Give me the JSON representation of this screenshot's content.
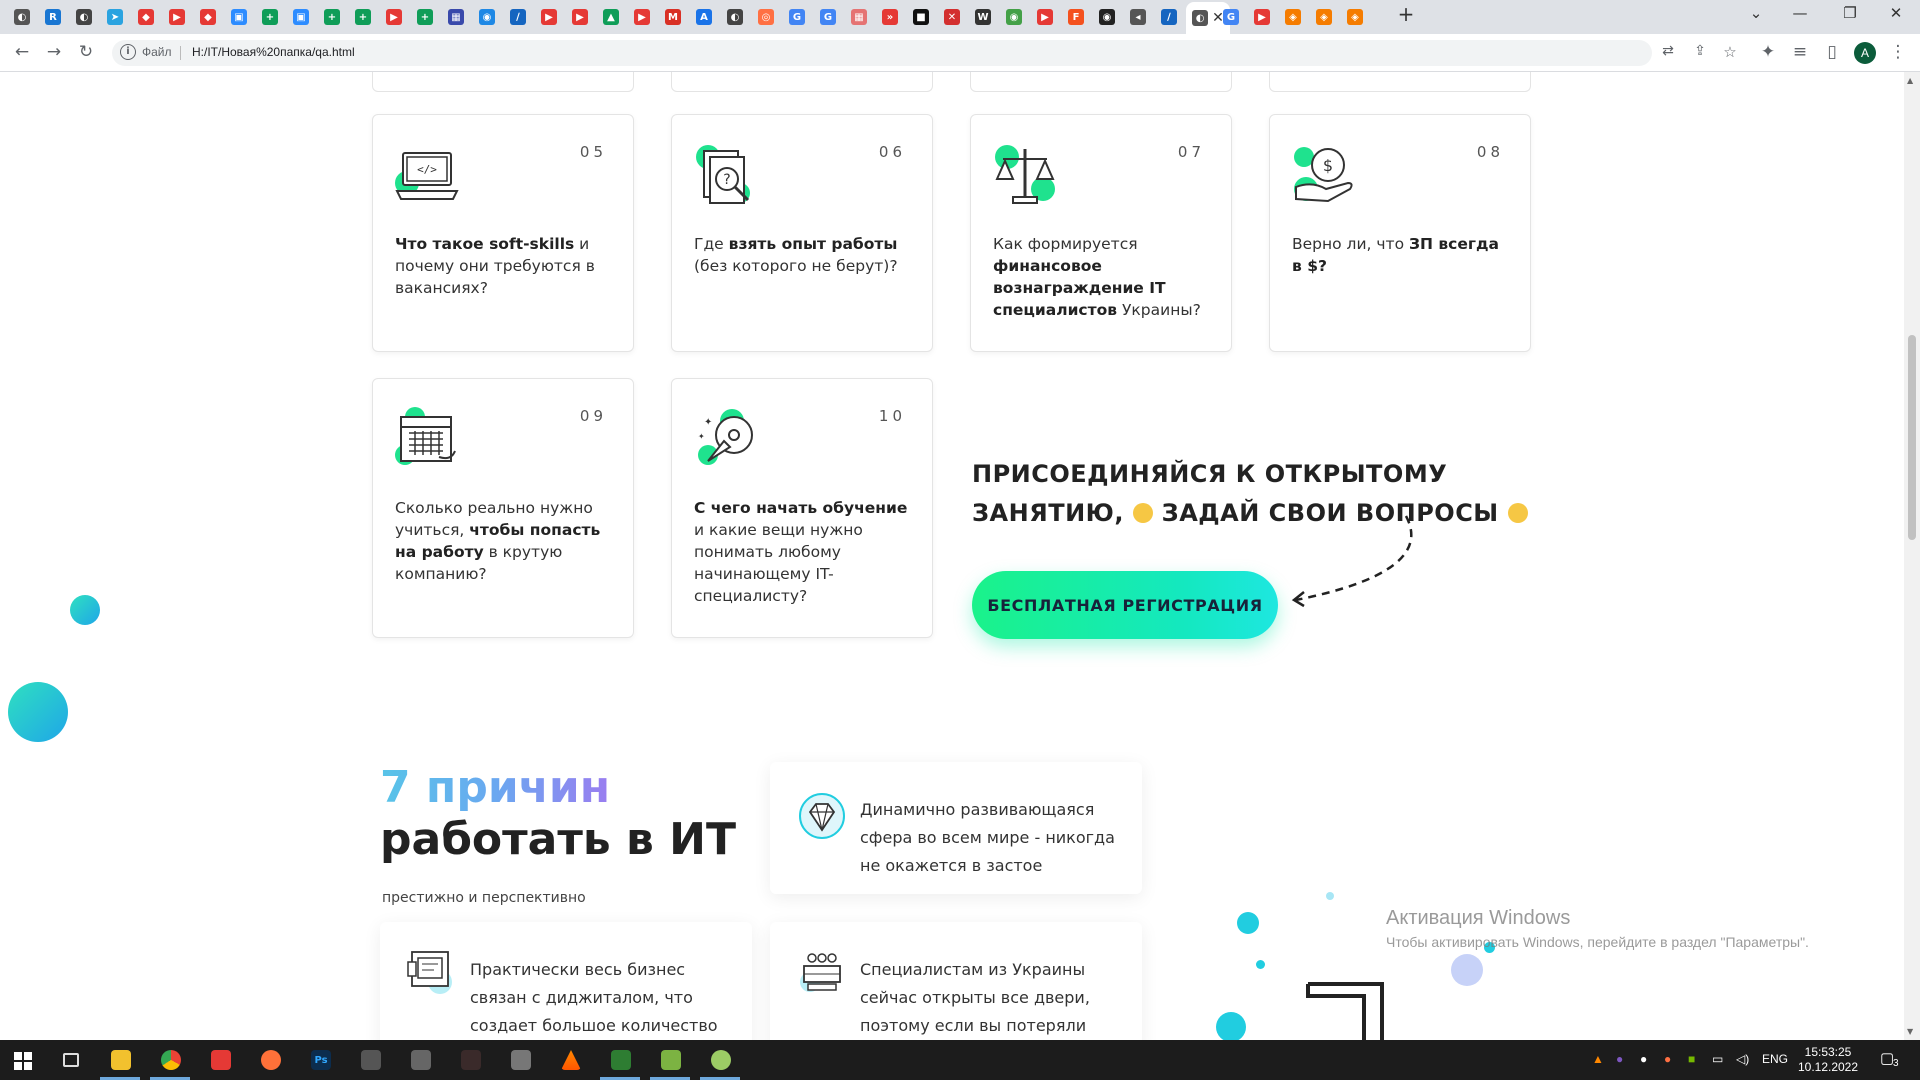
{
  "browser": {
    "tabs": [
      {
        "glyph": "◐",
        "color": "#555"
      },
      {
        "glyph": "R",
        "color": "#1976d2"
      },
      {
        "glyph": "◐",
        "color": "#444"
      },
      {
        "glyph": "➤",
        "color": "#2aa3e0"
      },
      {
        "glyph": "◆",
        "color": "#e53935"
      },
      {
        "glyph": "▶",
        "color": "#e53935"
      },
      {
        "glyph": "◆",
        "color": "#e53935"
      },
      {
        "glyph": "▣",
        "color": "#2d8cff"
      },
      {
        "glyph": "+",
        "color": "#0f9d58"
      },
      {
        "glyph": "▣",
        "color": "#2d8cff"
      },
      {
        "glyph": "+",
        "color": "#0f9d58"
      },
      {
        "glyph": "+",
        "color": "#0f9d58"
      },
      {
        "glyph": "▶",
        "color": "#e53935"
      },
      {
        "glyph": "+",
        "color": "#0f9d58"
      },
      {
        "glyph": "▦",
        "color": "#3949ab"
      },
      {
        "glyph": "◉",
        "color": "#1e88e5"
      },
      {
        "glyph": "∕",
        "color": "#1565c0"
      },
      {
        "glyph": "▶",
        "color": "#e53935"
      },
      {
        "glyph": "▶",
        "color": "#e53935"
      },
      {
        "glyph": "▲",
        "color": "#0f9d58"
      },
      {
        "glyph": "▶",
        "color": "#e53935"
      },
      {
        "glyph": "M",
        "color": "#d93025"
      },
      {
        "glyph": "A",
        "color": "#1a73e8"
      },
      {
        "glyph": "◐",
        "color": "#444"
      },
      {
        "glyph": "◎",
        "color": "#ff7043"
      },
      {
        "glyph": "G",
        "color": "#4285f4"
      },
      {
        "glyph": "G",
        "color": "#4285f4"
      },
      {
        "glyph": "▦",
        "color": "#e57373"
      },
      {
        "glyph": "»",
        "color": "#e53935"
      },
      {
        "glyph": "■",
        "color": "#111"
      },
      {
        "glyph": "✕",
        "color": "#d32f2f"
      },
      {
        "glyph": "W",
        "color": "#333"
      },
      {
        "glyph": "◉",
        "color": "#43a047"
      },
      {
        "glyph": "▶",
        "color": "#e53935"
      },
      {
        "glyph": "F",
        "color": "#f4511e"
      },
      {
        "glyph": "◉",
        "color": "#222"
      },
      {
        "glyph": "◂",
        "color": "#555"
      },
      {
        "glyph": "∕",
        "color": "#1565c0"
      },
      {
        "glyph": "◐",
        "color": "#555",
        "active": true
      },
      {
        "glyph": "G",
        "color": "#4285f4"
      },
      {
        "glyph": "▶",
        "color": "#e53935"
      },
      {
        "glyph": "◈",
        "color": "#f57c00"
      },
      {
        "glyph": "◈",
        "color": "#f57c00"
      },
      {
        "glyph": "◈",
        "color": "#f57c00"
      }
    ],
    "new_tab": "+",
    "address": {
      "scheme_label": "Файл",
      "url": "H:/IT/Новая%20папка/qa.html"
    },
    "profile_initial": "A"
  },
  "cards": [
    {
      "number": "05",
      "icon": "laptop-code-icon",
      "parts": [
        {
          "t": "Что такое soft-skills",
          "b": true
        },
        {
          "t": " и почему они требуются в вакансиях?",
          "b": false
        }
      ]
    },
    {
      "number": "06",
      "icon": "document-search-icon",
      "parts": [
        {
          "t": "Где ",
          "b": false
        },
        {
          "t": "взять опыт работы",
          "b": true
        },
        {
          "t": " (без которого не берут)?",
          "b": false
        }
      ]
    },
    {
      "number": "07",
      "icon": "scales-icon",
      "parts": [
        {
          "t": "Как формируется ",
          "b": false
        },
        {
          "t": "финансовое вознаграждение IT специалистов",
          "b": true
        },
        {
          "t": " Украины?",
          "b": false
        }
      ]
    },
    {
      "number": "08",
      "icon": "money-hand-icon",
      "parts": [
        {
          "t": "Верно ли, что ",
          "b": false
        },
        {
          "t": "ЗП всегда в $?",
          "b": true
        }
      ]
    },
    {
      "number": "09",
      "icon": "calendar-icon",
      "parts": [
        {
          "t": "Сколько реально нужно учиться, ",
          "b": false
        },
        {
          "t": "чтобы попасть на работу",
          "b": true
        },
        {
          "t": " в крутую компанию?",
          "b": false
        }
      ]
    },
    {
      "number": "10",
      "icon": "rocket-idea-icon",
      "parts": [
        {
          "t": "С чего начать обучение",
          "b": true
        },
        {
          "t": " и какие вещи нужно понимать любому начинающему IT-специалисту?",
          "b": false
        }
      ]
    }
  ],
  "cta": {
    "title_line1": "ПРИСОЕДИНЯЙСЯ К ОТКРЫТОМУ",
    "title_line2a": "ЗАНЯТИЮ,",
    "title_line2b": "ЗАДАЙ СВОИ ВОПРОСЫ",
    "button": "БЕСПЛАТНАЯ РЕГИСТРАЦИЯ"
  },
  "reasons": {
    "title_accent": "7 причин",
    "title_rest": "работать в ИТ",
    "subtitle": "престижно и перспективно",
    "items": [
      {
        "icon": "diamond-icon",
        "text": "Динамично развивающаяся сфера во всем мире - никогда не окажется в застое"
      },
      {
        "icon": "digital-business-icon",
        "text": "Практически весь бизнес связан с диджиталом, что создает большое количество"
      },
      {
        "icon": "team-icon",
        "text": "Специалистам из Украины сейчас открыты все двери, поэтому если вы потеряли"
      }
    ]
  },
  "activation": {
    "line1": "Активация Windows",
    "line2": "Чтобы активировать Windows, перейдите в раздел \"Параметры\"."
  },
  "taskbar": {
    "lang": "ENG",
    "time": "15:53:25",
    "date": "10.12.2022",
    "notifications": "3"
  },
  "colors": {
    "accent_green": "#14e8a0",
    "accent_cyan": "#22d3e0",
    "title_gradient": [
      "#58c4e8",
      "#9a7df0"
    ]
  }
}
